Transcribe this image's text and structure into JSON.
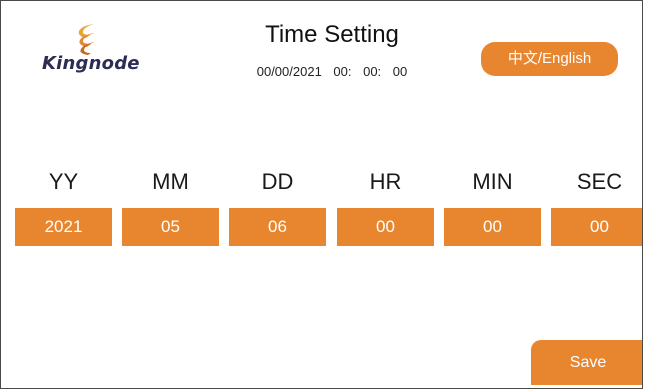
{
  "header": {
    "logo_text": "Kingnode",
    "title": "Time Setting",
    "current_datetime": "00/00/2021 00: 00: 00",
    "language_button_label": "中文/English"
  },
  "fields": [
    {
      "label": "YY",
      "value": "2021"
    },
    {
      "label": "MM",
      "value": "05"
    },
    {
      "label": "DD",
      "value": "06"
    },
    {
      "label": "HR",
      "value": "00"
    },
    {
      "label": "MIN",
      "value": "00"
    },
    {
      "label": "SEC",
      "value": "00"
    }
  ],
  "actions": {
    "save_label": "Save"
  },
  "colors": {
    "accent": "#e8862f",
    "logo_text": "#2c2c54",
    "border": "#4a4a4a"
  }
}
